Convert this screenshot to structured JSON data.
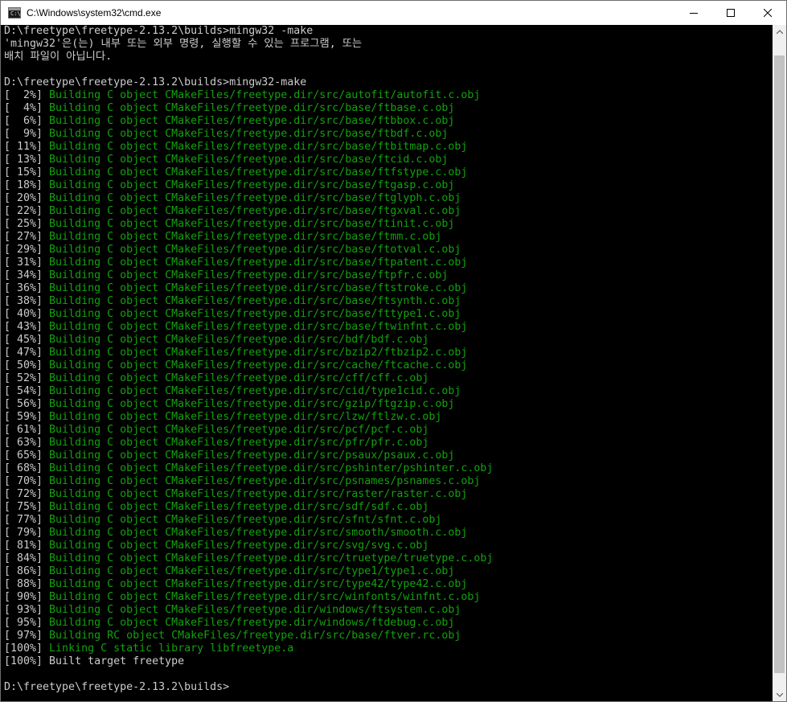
{
  "window": {
    "title": "C:\\Windows\\system32\\cmd.exe",
    "icon_label": "C:\\",
    "icons": [
      "minimize-icon",
      "maximize-icon",
      "close-icon"
    ]
  },
  "colors": {
    "background": "#000000",
    "text": "#cccccc",
    "build_green": "#13a10e"
  },
  "terminal": {
    "lines": [
      {
        "pct": "",
        "msg": "D:\\freetype\\freetype-2.13.2\\builds>mingw32 -make",
        "color": "white"
      },
      {
        "pct": "",
        "msg": "'mingw32'은(는) 내부 또는 외부 명령, 실행할 수 있는 프로그램, 또는",
        "color": "white"
      },
      {
        "pct": "",
        "msg": "배치 파일이 아닙니다.",
        "color": "white"
      },
      {
        "pct": "",
        "msg": "",
        "color": "white"
      },
      {
        "pct": "",
        "msg": "D:\\freetype\\freetype-2.13.2\\builds>mingw32-make",
        "color": "white"
      },
      {
        "pct": "[  2%] ",
        "msg": "Building C object CMakeFiles/freetype.dir/src/autofit/autofit.c.obj",
        "color": "green"
      },
      {
        "pct": "[  4%] ",
        "msg": "Building C object CMakeFiles/freetype.dir/src/base/ftbase.c.obj",
        "color": "green"
      },
      {
        "pct": "[  6%] ",
        "msg": "Building C object CMakeFiles/freetype.dir/src/base/ftbbox.c.obj",
        "color": "green"
      },
      {
        "pct": "[  9%] ",
        "msg": "Building C object CMakeFiles/freetype.dir/src/base/ftbdf.c.obj",
        "color": "green"
      },
      {
        "pct": "[ 11%] ",
        "msg": "Building C object CMakeFiles/freetype.dir/src/base/ftbitmap.c.obj",
        "color": "green"
      },
      {
        "pct": "[ 13%] ",
        "msg": "Building C object CMakeFiles/freetype.dir/src/base/ftcid.c.obj",
        "color": "green"
      },
      {
        "pct": "[ 15%] ",
        "msg": "Building C object CMakeFiles/freetype.dir/src/base/ftfstype.c.obj",
        "color": "green"
      },
      {
        "pct": "[ 18%] ",
        "msg": "Building C object CMakeFiles/freetype.dir/src/base/ftgasp.c.obj",
        "color": "green"
      },
      {
        "pct": "[ 20%] ",
        "msg": "Building C object CMakeFiles/freetype.dir/src/base/ftglyph.c.obj",
        "color": "green"
      },
      {
        "pct": "[ 22%] ",
        "msg": "Building C object CMakeFiles/freetype.dir/src/base/ftgxval.c.obj",
        "color": "green"
      },
      {
        "pct": "[ 25%] ",
        "msg": "Building C object CMakeFiles/freetype.dir/src/base/ftinit.c.obj",
        "color": "green"
      },
      {
        "pct": "[ 27%] ",
        "msg": "Building C object CMakeFiles/freetype.dir/src/base/ftmm.c.obj",
        "color": "green"
      },
      {
        "pct": "[ 29%] ",
        "msg": "Building C object CMakeFiles/freetype.dir/src/base/ftotval.c.obj",
        "color": "green"
      },
      {
        "pct": "[ 31%] ",
        "msg": "Building C object CMakeFiles/freetype.dir/src/base/ftpatent.c.obj",
        "color": "green"
      },
      {
        "pct": "[ 34%] ",
        "msg": "Building C object CMakeFiles/freetype.dir/src/base/ftpfr.c.obj",
        "color": "green"
      },
      {
        "pct": "[ 36%] ",
        "msg": "Building C object CMakeFiles/freetype.dir/src/base/ftstroke.c.obj",
        "color": "green"
      },
      {
        "pct": "[ 38%] ",
        "msg": "Building C object CMakeFiles/freetype.dir/src/base/ftsynth.c.obj",
        "color": "green"
      },
      {
        "pct": "[ 40%] ",
        "msg": "Building C object CMakeFiles/freetype.dir/src/base/fttype1.c.obj",
        "color": "green"
      },
      {
        "pct": "[ 43%] ",
        "msg": "Building C object CMakeFiles/freetype.dir/src/base/ftwinfnt.c.obj",
        "color": "green"
      },
      {
        "pct": "[ 45%] ",
        "msg": "Building C object CMakeFiles/freetype.dir/src/bdf/bdf.c.obj",
        "color": "green"
      },
      {
        "pct": "[ 47%] ",
        "msg": "Building C object CMakeFiles/freetype.dir/src/bzip2/ftbzip2.c.obj",
        "color": "green"
      },
      {
        "pct": "[ 50%] ",
        "msg": "Building C object CMakeFiles/freetype.dir/src/cache/ftcache.c.obj",
        "color": "green"
      },
      {
        "pct": "[ 52%] ",
        "msg": "Building C object CMakeFiles/freetype.dir/src/cff/cff.c.obj",
        "color": "green"
      },
      {
        "pct": "[ 54%] ",
        "msg": "Building C object CMakeFiles/freetype.dir/src/cid/type1cid.c.obj",
        "color": "green"
      },
      {
        "pct": "[ 56%] ",
        "msg": "Building C object CMakeFiles/freetype.dir/src/gzip/ftgzip.c.obj",
        "color": "green"
      },
      {
        "pct": "[ 59%] ",
        "msg": "Building C object CMakeFiles/freetype.dir/src/lzw/ftlzw.c.obj",
        "color": "green"
      },
      {
        "pct": "[ 61%] ",
        "msg": "Building C object CMakeFiles/freetype.dir/src/pcf/pcf.c.obj",
        "color": "green"
      },
      {
        "pct": "[ 63%] ",
        "msg": "Building C object CMakeFiles/freetype.dir/src/pfr/pfr.c.obj",
        "color": "green"
      },
      {
        "pct": "[ 65%] ",
        "msg": "Building C object CMakeFiles/freetype.dir/src/psaux/psaux.c.obj",
        "color": "green"
      },
      {
        "pct": "[ 68%] ",
        "msg": "Building C object CMakeFiles/freetype.dir/src/pshinter/pshinter.c.obj",
        "color": "green"
      },
      {
        "pct": "[ 70%] ",
        "msg": "Building C object CMakeFiles/freetype.dir/src/psnames/psnames.c.obj",
        "color": "green"
      },
      {
        "pct": "[ 72%] ",
        "msg": "Building C object CMakeFiles/freetype.dir/src/raster/raster.c.obj",
        "color": "green"
      },
      {
        "pct": "[ 75%] ",
        "msg": "Building C object CMakeFiles/freetype.dir/src/sdf/sdf.c.obj",
        "color": "green"
      },
      {
        "pct": "[ 77%] ",
        "msg": "Building C object CMakeFiles/freetype.dir/src/sfnt/sfnt.c.obj",
        "color": "green"
      },
      {
        "pct": "[ 79%] ",
        "msg": "Building C object CMakeFiles/freetype.dir/src/smooth/smooth.c.obj",
        "color": "green"
      },
      {
        "pct": "[ 81%] ",
        "msg": "Building C object CMakeFiles/freetype.dir/src/svg/svg.c.obj",
        "color": "green"
      },
      {
        "pct": "[ 84%] ",
        "msg": "Building C object CMakeFiles/freetype.dir/src/truetype/truetype.c.obj",
        "color": "green"
      },
      {
        "pct": "[ 86%] ",
        "msg": "Building C object CMakeFiles/freetype.dir/src/type1/type1.c.obj",
        "color": "green"
      },
      {
        "pct": "[ 88%] ",
        "msg": "Building C object CMakeFiles/freetype.dir/src/type42/type42.c.obj",
        "color": "green"
      },
      {
        "pct": "[ 90%] ",
        "msg": "Building C object CMakeFiles/freetype.dir/src/winfonts/winfnt.c.obj",
        "color": "green"
      },
      {
        "pct": "[ 93%] ",
        "msg": "Building C object CMakeFiles/freetype.dir/windows/ftsystem.c.obj",
        "color": "green"
      },
      {
        "pct": "[ 95%] ",
        "msg": "Building C object CMakeFiles/freetype.dir/windows/ftdebug.c.obj",
        "color": "green"
      },
      {
        "pct": "[ 97%] ",
        "msg": "Building RC object CMakeFiles/freetype.dir/src/base/ftver.rc.obj",
        "color": "green"
      },
      {
        "pct": "[100%] ",
        "msg": "Linking C static library libfreetype.a",
        "color": "green"
      },
      {
        "pct": "[100%] ",
        "msg": "Built target freetype",
        "color": "white"
      },
      {
        "pct": "",
        "msg": "",
        "color": "white"
      },
      {
        "pct": "",
        "msg": "D:\\freetype\\freetype-2.13.2\\builds>",
        "color": "white"
      }
    ]
  }
}
